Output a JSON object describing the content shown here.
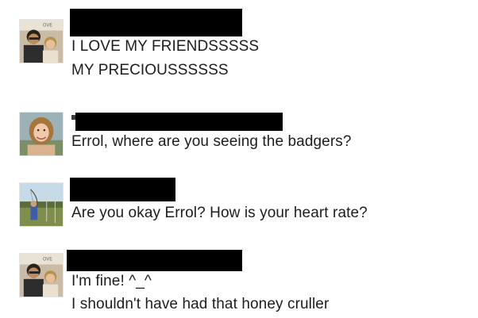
{
  "comments": [
    {
      "author": {
        "name_redacted": true,
        "avatar_icon": "couple-photo-avatar-icon"
      },
      "lines": [
        "I LOVE MY FRIENDSSSSS",
        "MY PRECIOUSSSSSS"
      ]
    },
    {
      "author": {
        "name_redacted": true,
        "avatar_icon": "woman-portrait-avatar-icon"
      },
      "lines": [
        "Errol, where are you seeing the badgers?"
      ]
    },
    {
      "author": {
        "name_redacted": true,
        "avatar_icon": "outdoor-archery-avatar-icon"
      },
      "lines": [
        "Are you okay Errol? How is your heart rate?"
      ]
    },
    {
      "author": {
        "name_redacted": true,
        "avatar_icon": "couple-photo-avatar-icon"
      },
      "lines": [
        "I'm fine! ^_^",
        "I shouldn't have had that honey cruller"
      ]
    }
  ],
  "colors": {
    "text": "#1d1d1d",
    "redaction": "#000000",
    "background": "#ffffff"
  }
}
